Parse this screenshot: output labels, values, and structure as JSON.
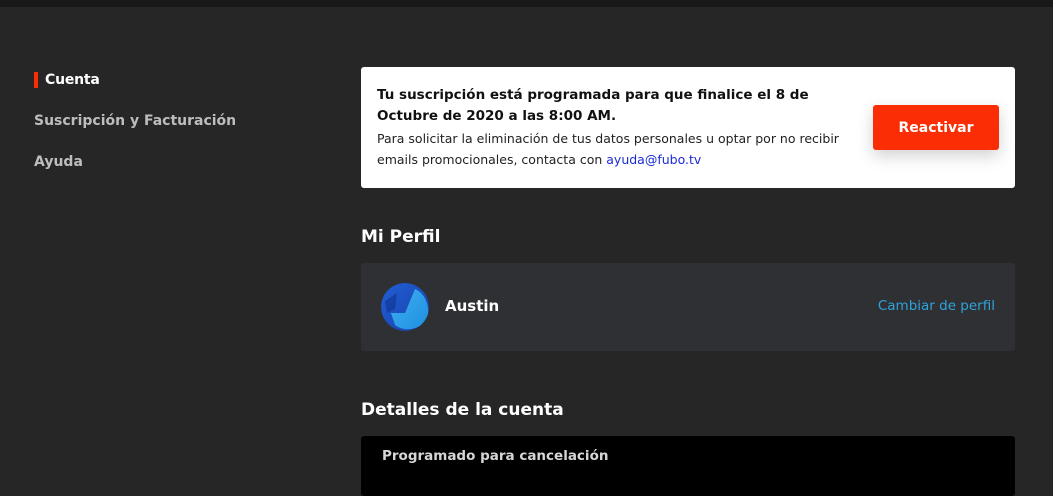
{
  "sidebar": {
    "items": [
      {
        "label": "Cuenta",
        "active": true
      },
      {
        "label": "Suscripción y Facturación",
        "active": false
      },
      {
        "label": "Ayuda",
        "active": false
      }
    ]
  },
  "notice": {
    "title": "Tu suscripción está programada para que finalice el 8 de Octubre de 2020 a las 8:00 AM.",
    "body": "Para solicitar la eliminación de tus datos personales u optar por no recibir emails promocionales, contacta con",
    "email": "ayuda@fubo.tv",
    "button_label": "Reactivar"
  },
  "profile": {
    "section_title": "Mi Perfil",
    "name": "Austin",
    "change_label": "Cambiar de perfil"
  },
  "account": {
    "section_title": "Detalles de la cuenta",
    "status": "Programado para cancelación"
  },
  "colors": {
    "accent": "#fa2d05",
    "link": "#2fa3dc",
    "background": "#262626",
    "card": "#2f3034"
  }
}
